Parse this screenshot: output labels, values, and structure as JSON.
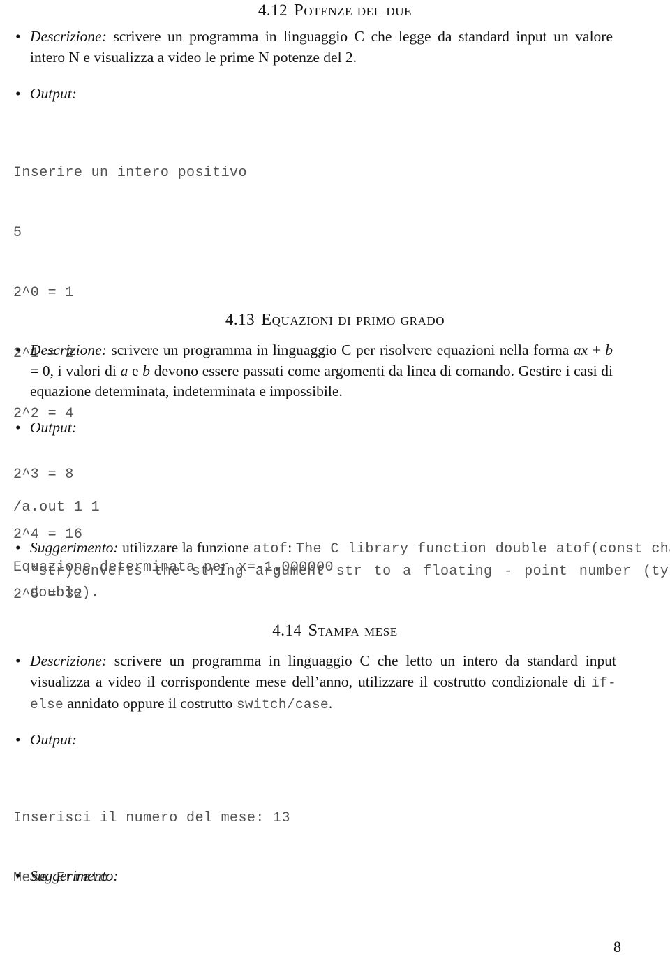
{
  "document": {
    "page_number": "8",
    "bullet_glyph": "•"
  },
  "sections": [
    {
      "number": "4.12",
      "title": "Potenze del due",
      "description_label": "Descrizione:",
      "description_text": " scrivere un programma in linguaggio C che legge da standard input un valore intero N e visualizza a video le prime N potenze del 2.",
      "output_label": "Output:",
      "output_lines": [
        "Inserire un intero positivo",
        "5",
        "2^0 = 1",
        "2^1 = 2",
        "2^2 = 4",
        "2^3 = 8",
        "2^4 = 16",
        "2^5 = 32"
      ]
    },
    {
      "number": "4.13",
      "title": "Equazioni di primo grado",
      "description_label": "Descrizione:",
      "description_text_1": " scrivere un programma in linguaggio C per risolvere equazioni nella forma ",
      "formula_a": "ax",
      "formula_plus": " + ",
      "formula_b": "b",
      "formula_eq": " = 0",
      "description_text_2": ", i valori di ",
      "var_a": "a",
      "description_text_3": " e ",
      "var_b": "b",
      "description_text_4": " devono essere passati come argomenti da linea di comando. Gestire i casi di equazione determinata, indeterminata e impossibile.",
      "output_label": "Output:",
      "output_lines": [
        "/a.out 1 1",
        "Equazione determinata per x=-1.000000"
      ],
      "hint_label": "Suggerimento:",
      "hint_text_1": " utilizzare la funzione ",
      "hint_code_1": "atof",
      "hint_text_2": ": ",
      "hint_code_2": "The C library function double atof(const char *str)",
      "hint_code_3": "converts the string argument str to a floating - point number (type double)."
    },
    {
      "number": "4.14",
      "title": "Stampa mese",
      "description_label": "Descrizione:",
      "description_text_1": " scrivere un programma in linguaggio C che letto un intero da standard input visualizza a video il corrispondente mese dell’anno, utilizzare il costrutto condizionale di ",
      "description_code_1": "if-else",
      "description_text_2": " annidato oppure il costrutto ",
      "description_code_2": "switch/case",
      "description_text_3": ".",
      "output_label": "Output:",
      "output_lines": [
        "Inserisci il numero del mese: 13",
        "Mese Errato"
      ],
      "hint_label": "Suggerimento:"
    }
  ]
}
